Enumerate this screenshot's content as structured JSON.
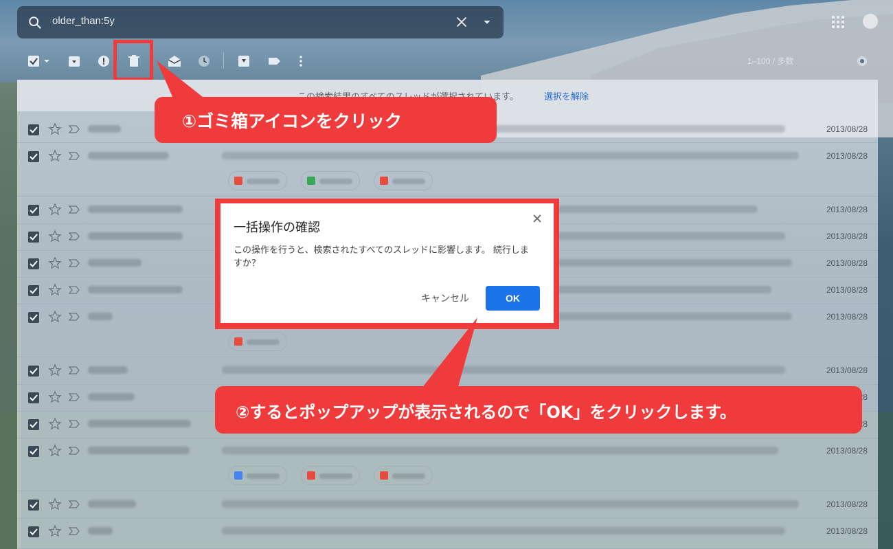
{
  "search": {
    "query": "older_than:5y"
  },
  "toolbar": {
    "icons": [
      "select-all-checkbox",
      "archive-icon",
      "spam-icon",
      "trash-icon",
      "mark-read-icon",
      "snooze-icon",
      "move-to-icon",
      "label-icon",
      "more-icon"
    ],
    "pager": "1–100 / 多数"
  },
  "banner": {
    "text": "この検索結果のすべてのスレッドが選択されています。",
    "link": "選択を解除"
  },
  "rows": [
    {
      "date": "2013/08/28"
    },
    {
      "date": "2013/08/28"
    },
    {
      "date": "2013/08/28"
    },
    {
      "date": "2013/08/28"
    },
    {
      "date": "2013/08/28"
    },
    {
      "date": "2013/08/28"
    },
    {
      "date": "2013/08/28"
    },
    {
      "date": "2013/08/28"
    },
    {
      "date": "2013/08/28"
    },
    {
      "date": "2013/08/28"
    },
    {
      "date": "2013/08/28"
    },
    {
      "date": "2013/08/28"
    },
    {
      "date": "2013/08/28"
    }
  ],
  "dialog": {
    "title": "一括操作の確認",
    "message": "この操作を行うと、検索されたすべてのスレッドに影響します。 続行しますか？",
    "cancel_label": "キャンセル",
    "ok_label": "OK"
  },
  "callouts": {
    "step1": "①ゴミ箱アイコンをクリック",
    "step2": "②するとポップアップが表示されるので「OK」をクリックします。"
  },
  "colors": {
    "accent": "#ef3b3b",
    "ok_button": "#1a73e8",
    "link": "#2a6bd6"
  }
}
